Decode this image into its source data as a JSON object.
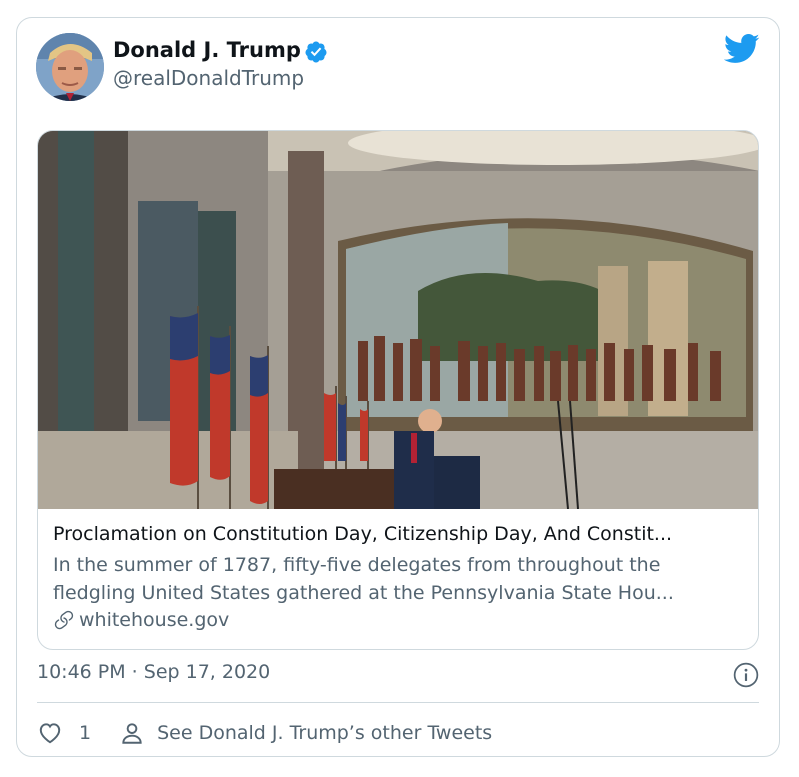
{
  "tweet": {
    "author_name": "Donald J. Trump",
    "author_handle": "@realDonaldTrump",
    "timestamp": "10:46 PM · Sep 17, 2020",
    "like_count": "1",
    "see_more_label": "See Donald J. Trump’s other Tweets"
  },
  "link_card": {
    "title": "Proclamation on Constitution Day, Citizenship Day, And Constit...",
    "description": "In the summer of 1787, fifty-five delegates from throughout the fledgling United States gathered at the Pennsylvania State Hou...",
    "domain": "whitehouse.gov"
  },
  "colors": {
    "twitter_blue": "#1d9bf0",
    "text_primary": "#0f1419",
    "text_secondary": "#536471",
    "border": "#cfd9de"
  },
  "icons": [
    "verified-badge-icon",
    "twitter-bird-icon",
    "link-icon",
    "info-icon",
    "heart-icon",
    "person-icon"
  ]
}
